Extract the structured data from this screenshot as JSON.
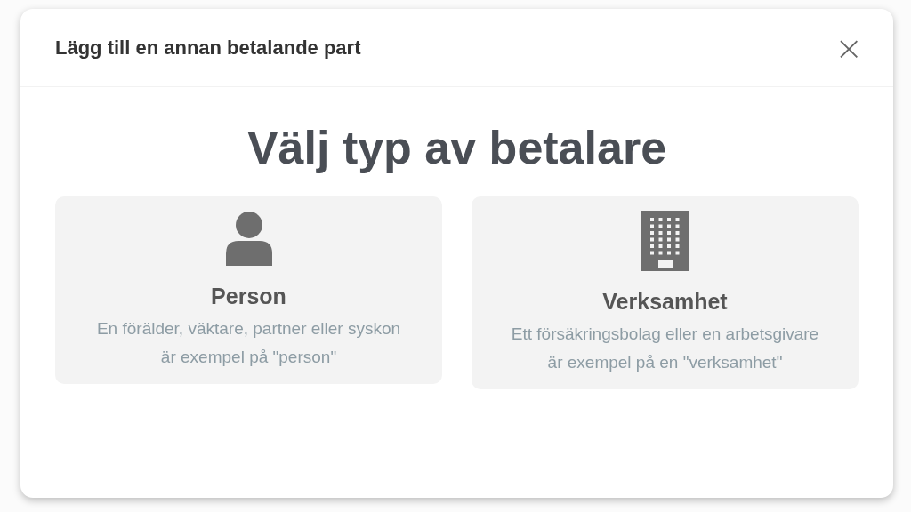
{
  "dialog": {
    "title": "Lägg till en annan betalande part",
    "close": "×"
  },
  "heading": "Välj typ av betalare",
  "options": [
    {
      "kind": "person",
      "title": "Person",
      "description": "En förälder, väktare, partner eller syskon är exempel på \"person\""
    },
    {
      "kind": "business",
      "title": "Verksamhet",
      "description": "Ett försäkringsbolag eller en arbetsgivare är exempel på en \"verksamhet\""
    }
  ]
}
